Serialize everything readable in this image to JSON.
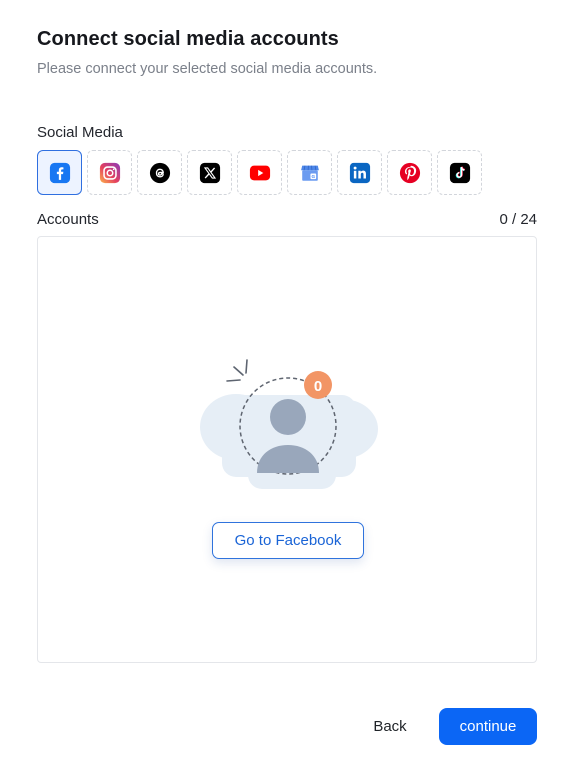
{
  "header": {
    "title": "Connect social media accounts",
    "subtitle": "Please connect your selected social media accounts."
  },
  "social_media": {
    "label": "Social Media",
    "selected": "facebook",
    "platforms": [
      {
        "id": "facebook",
        "icon": "facebook-icon",
        "color": "#1877F2"
      },
      {
        "id": "instagram",
        "icon": "instagram-icon",
        "color": "#E1306C"
      },
      {
        "id": "threads",
        "icon": "threads-icon",
        "color": "#000000"
      },
      {
        "id": "x",
        "icon": "x-icon",
        "color": "#000000"
      },
      {
        "id": "youtube",
        "icon": "youtube-icon",
        "color": "#FF0000"
      },
      {
        "id": "google-business",
        "icon": "google-business-icon",
        "color": "#4285F4"
      },
      {
        "id": "linkedin",
        "icon": "linkedin-icon",
        "color": "#0A66C2"
      },
      {
        "id": "pinterest",
        "icon": "pinterest-icon",
        "color": "#E60023"
      },
      {
        "id": "tiktok",
        "icon": "tiktok-icon",
        "color": "#000000"
      }
    ]
  },
  "accounts": {
    "label": "Accounts",
    "count": "0 / 24",
    "badge": "0",
    "goto_label": "Go to Facebook"
  },
  "footer": {
    "back_label": "Back",
    "continue_label": "continue"
  },
  "colors": {
    "accent": "#0b66f5",
    "badge": "#f29565",
    "illustration_bg": "#e6eef6"
  }
}
